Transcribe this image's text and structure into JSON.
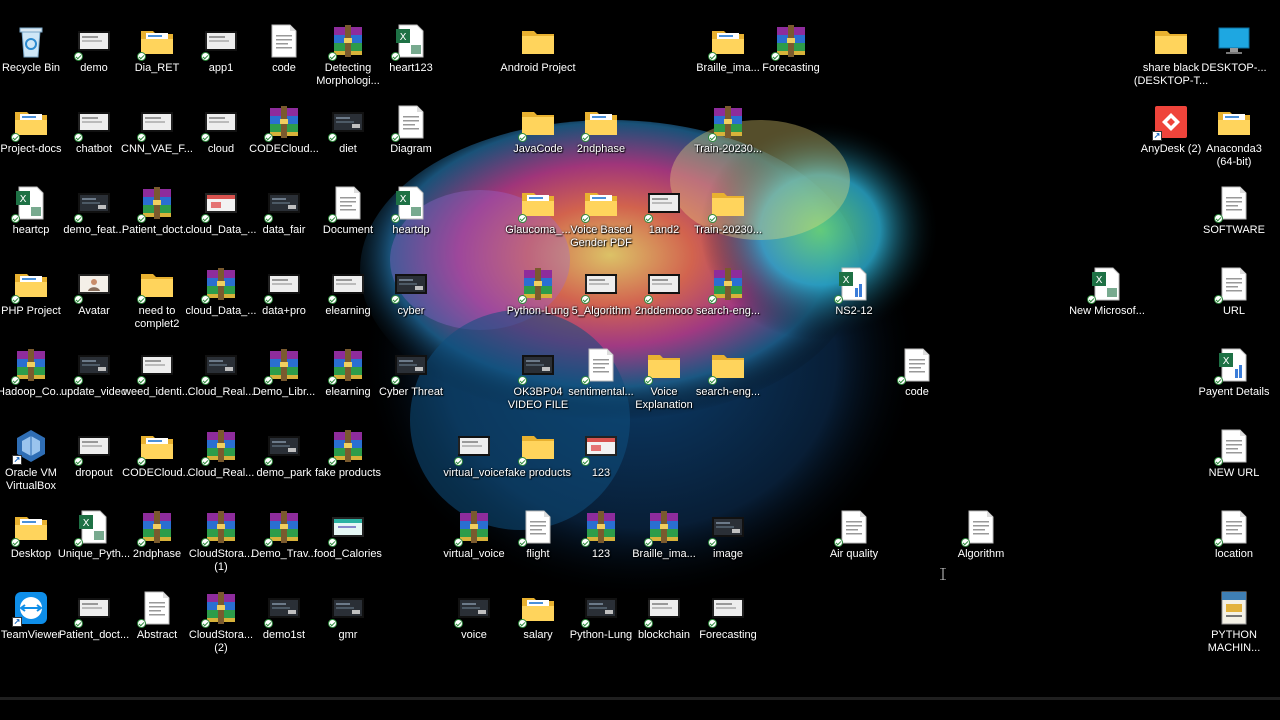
{
  "desktop": {
    "icons": [
      {
        "label": "Recycle Bin",
        "type": "recycle",
        "badge": false
      },
      {
        "label": "demo",
        "type": "video",
        "badge": true
      },
      {
        "label": "Dia_RET",
        "type": "folder-docs",
        "badge": true
      },
      {
        "label": "app1",
        "type": "video",
        "badge": true
      },
      {
        "label": "code",
        "type": "doc",
        "badge": false
      },
      {
        "label": "Detecting Morphologi...",
        "type": "rar",
        "badge": true
      },
      {
        "label": "heart123",
        "type": "excel",
        "badge": true
      },
      {
        "label": "Android Project",
        "type": "folder",
        "badge": false
      },
      {
        "label": "Braille_ima...",
        "type": "folder-docs",
        "badge": true
      },
      {
        "label": "Forecasting",
        "type": "rar",
        "badge": true
      },
      {
        "label": "share black (DESKTOP-T...",
        "type": "folder",
        "badge": false
      },
      {
        "label": "DESKTOP-...",
        "type": "monitor",
        "badge": false
      },
      {
        "label": "Project-docs",
        "type": "folder-docs",
        "badge": true
      },
      {
        "label": "chatbot",
        "type": "video",
        "badge": true
      },
      {
        "label": "CNN_VAE_F...",
        "type": "video",
        "badge": true
      },
      {
        "label": "cloud",
        "type": "video",
        "badge": true
      },
      {
        "label": "CODECloud...",
        "type": "rar",
        "badge": true
      },
      {
        "label": "diet",
        "type": "video-dark",
        "badge": true
      },
      {
        "label": "Diagram",
        "type": "doc",
        "badge": true
      },
      {
        "label": "JavaCode",
        "type": "folder",
        "badge": true
      },
      {
        "label": "2ndphase",
        "type": "folder-docs",
        "badge": true
      },
      {
        "label": "Train-20230...",
        "type": "rar",
        "badge": true
      },
      {
        "label": "AnyDesk (2)",
        "type": "anydesk",
        "badge": false
      },
      {
        "label": "Anaconda3 (64-bit)",
        "type": "folder-docs",
        "badge": false
      },
      {
        "label": "heartcp",
        "type": "excel",
        "badge": true
      },
      {
        "label": "demo_feat...",
        "type": "video-dark",
        "badge": true
      },
      {
        "label": "Patient_doct...",
        "type": "rar",
        "badge": true
      },
      {
        "label": "cloud_Data_...",
        "type": "video-red",
        "badge": true
      },
      {
        "label": "data_fair",
        "type": "video-dark",
        "badge": true
      },
      {
        "label": "Document",
        "type": "doc",
        "badge": true
      },
      {
        "label": "heartdp",
        "type": "excel",
        "badge": true
      },
      {
        "label": "Glaucoma_...",
        "type": "folder-docs",
        "badge": true
      },
      {
        "label": "Voice Based Gender PDF",
        "type": "folder-docs",
        "badge": true
      },
      {
        "label": "1and2",
        "type": "video",
        "badge": true
      },
      {
        "label": "Train-20230...",
        "type": "folder",
        "badge": true
      },
      {
        "label": "SOFTWARE",
        "type": "doc",
        "badge": true
      },
      {
        "label": "PHP Project",
        "type": "folder-docs",
        "badge": true
      },
      {
        "label": "Avatar",
        "type": "video-person",
        "badge": true
      },
      {
        "label": "need to complet2",
        "type": "folder",
        "badge": true
      },
      {
        "label": "cloud_Data_...",
        "type": "rar",
        "badge": true
      },
      {
        "label": "data+pro",
        "type": "video",
        "badge": true
      },
      {
        "label": "elearning",
        "type": "video",
        "badge": true
      },
      {
        "label": "cyber",
        "type": "video-dark",
        "badge": true
      },
      {
        "label": "Python-Lung",
        "type": "rar",
        "badge": true
      },
      {
        "label": "5_Algorithm",
        "type": "video",
        "badge": true
      },
      {
        "label": "2nddemooo",
        "type": "video",
        "badge": true
      },
      {
        "label": "search-eng...",
        "type": "rar",
        "badge": true
      },
      {
        "label": "NS2-12",
        "type": "excel-bar",
        "badge": true
      },
      {
        "label": "New Microsof...",
        "type": "excel",
        "badge": true
      },
      {
        "label": "URL",
        "type": "doc",
        "badge": true
      },
      {
        "label": "Hadoop_Co...",
        "type": "rar",
        "badge": true
      },
      {
        "label": "update_video",
        "type": "video-dark",
        "badge": true
      },
      {
        "label": "weed_identi...",
        "type": "video",
        "badge": true
      },
      {
        "label": "Cloud_Real...",
        "type": "video-dark",
        "badge": true
      },
      {
        "label": "Demo_Libr...",
        "type": "rar",
        "badge": true
      },
      {
        "label": "elearning",
        "type": "rar",
        "badge": true
      },
      {
        "label": "Cyber Threat",
        "type": "video-dark",
        "badge": true
      },
      {
        "label": "OK3BP04 VIDEO FILE",
        "type": "video-dark",
        "badge": true
      },
      {
        "label": "sentimental...",
        "type": "doc",
        "badge": true
      },
      {
        "label": "Voice Explanation",
        "type": "folder",
        "badge": true
      },
      {
        "label": "search-eng...",
        "type": "folder",
        "badge": true
      },
      {
        "label": "code",
        "type": "doc",
        "badge": true
      },
      {
        "label": "Payent Details",
        "type": "excel-bar",
        "badge": true
      },
      {
        "label": "Oracle VM VirtualBox",
        "type": "virtualbox",
        "badge": false
      },
      {
        "label": "dropout",
        "type": "video",
        "badge": true
      },
      {
        "label": "CODECloud...",
        "type": "folder-docs",
        "badge": true
      },
      {
        "label": "Cloud_Real...",
        "type": "rar",
        "badge": true
      },
      {
        "label": "demo_park",
        "type": "video-dark",
        "badge": true
      },
      {
        "label": "fake products",
        "type": "rar",
        "badge": true
      },
      {
        "label": "virtual_voice",
        "type": "video",
        "badge": true
      },
      {
        "label": "fake products",
        "type": "folder",
        "badge": true
      },
      {
        "label": "123",
        "type": "video-red",
        "badge": true
      },
      {
        "label": "NEW URL",
        "type": "doc",
        "badge": true
      },
      {
        "label": "Desktop",
        "type": "folder-docs",
        "badge": true
      },
      {
        "label": "Unique_Pyth...",
        "type": "excel",
        "badge": true
      },
      {
        "label": "2ndphase",
        "type": "rar",
        "badge": true
      },
      {
        "label": "CloudStora... (1)",
        "type": "rar",
        "badge": true
      },
      {
        "label": "Demo_Trav...",
        "type": "rar",
        "badge": true
      },
      {
        "label": "food_Calories",
        "type": "video-teal",
        "badge": true
      },
      {
        "label": "virtual_voice",
        "type": "rar",
        "badge": true
      },
      {
        "label": "flight",
        "type": "doc",
        "badge": true
      },
      {
        "label": "123",
        "type": "rar",
        "badge": true
      },
      {
        "label": "Braille_ima...",
        "type": "rar",
        "badge": true
      },
      {
        "label": "image",
        "type": "video-dark",
        "badge": true
      },
      {
        "label": "Air quality",
        "type": "doc",
        "badge": true
      },
      {
        "label": "Algorithm",
        "type": "doc",
        "badge": true
      },
      {
        "label": "location",
        "type": "doc",
        "badge": true
      },
      {
        "label": "TeamViewer",
        "type": "teamviewer",
        "badge": false
      },
      {
        "label": "Patient_doct...",
        "type": "video",
        "badge": true
      },
      {
        "label": "Abstract",
        "type": "doc",
        "badge": true
      },
      {
        "label": "CloudStora... (2)",
        "type": "rar",
        "badge": true
      },
      {
        "label": "demo1st",
        "type": "video-dark",
        "badge": true
      },
      {
        "label": "gmr",
        "type": "video-dark",
        "badge": true
      },
      {
        "label": "voice",
        "type": "video-dark",
        "badge": true
      },
      {
        "label": "salary",
        "type": "folder-docs",
        "badge": true
      },
      {
        "label": "Python-Lung",
        "type": "video-dark",
        "badge": true
      },
      {
        "label": "blockchain",
        "type": "video",
        "badge": true
      },
      {
        "label": "Forecasting",
        "type": "video",
        "badge": true
      },
      {
        "label": "PYTHON MACHIN...",
        "type": "book",
        "badge": false
      }
    ]
  }
}
